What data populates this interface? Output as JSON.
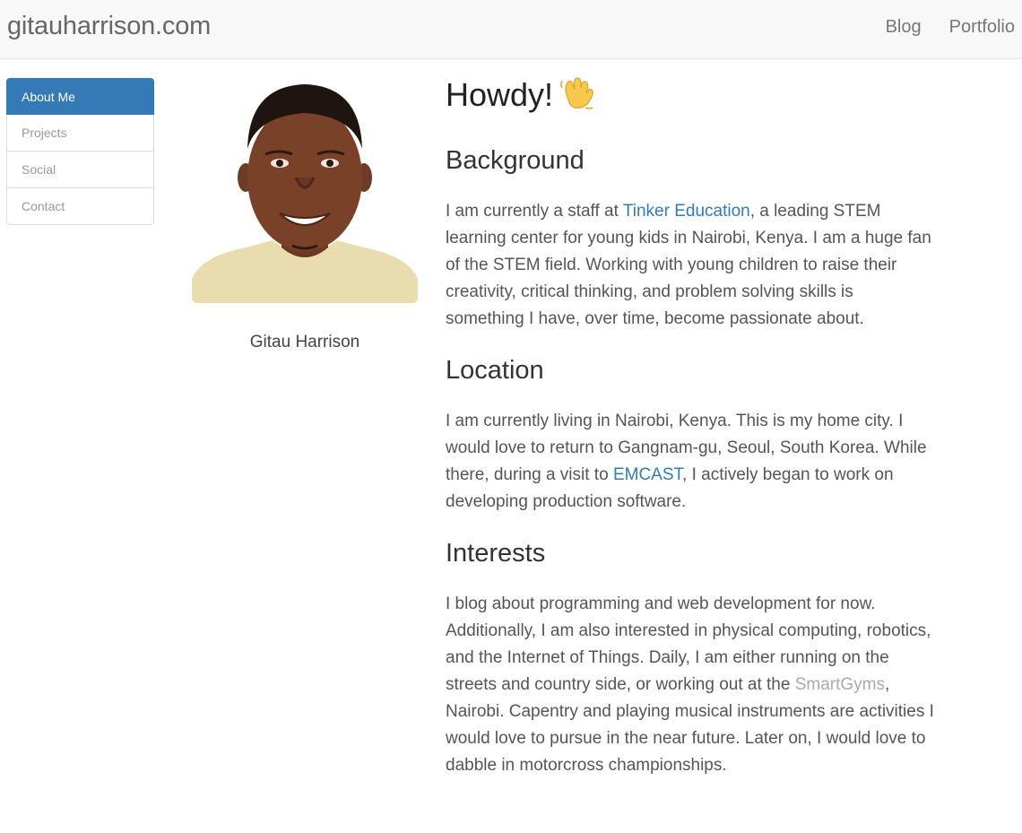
{
  "navbar": {
    "brand": "gitauharrison.com",
    "links": [
      {
        "label": "Blog"
      },
      {
        "label": "Portfolio"
      }
    ]
  },
  "sidebar": {
    "items": [
      {
        "label": "About Me",
        "active": true
      },
      {
        "label": "Projects",
        "active": false
      },
      {
        "label": "Social",
        "active": false
      },
      {
        "label": "Contact",
        "active": false
      }
    ]
  },
  "profile": {
    "name": "Gitau Harrison"
  },
  "content": {
    "heading": "Howdy!",
    "wave_icon": "waving-hand-icon",
    "sections": [
      {
        "title": "Background",
        "parts": [
          {
            "text": "I am currently a staff at "
          },
          {
            "link": "Tinker Education"
          },
          {
            "text": ", a leading STEM learning center for young kids in Nairobi, Kenya. I am a huge fan of the STEM field. Working with young children to raise their creativity, critical thinking, and problem solving skills is something I have, over time, become passionate about."
          }
        ]
      },
      {
        "title": "Location",
        "parts": [
          {
            "text": "I am currently living in Nairobi, Kenya. This is my home city. I would love to return to Gangnam-gu, Seoul, South Korea. While there, during a visit to "
          },
          {
            "link": "EMCAST"
          },
          {
            "text": ", I actively began to work on developing production software."
          }
        ]
      },
      {
        "title": "Interests",
        "parts": [
          {
            "text": "I blog about programming and web development for now. Additionally, I am also interested in physical computing, robotics, and the Internet of Things. Daily, I am either running on the streets and country side, or working out at the "
          },
          {
            "link": "SmartGyms"
          },
          {
            "text": ", Nairobi. Capentry and playing musical instruments are activities I would love to pursue in the near future. Later on, I would love to dabble in motorcross championships."
          }
        ]
      }
    ]
  },
  "colors": {
    "accent": "#337ab7",
    "navbar_bg": "#f8f8f8",
    "muted_link": "#aaaaaa"
  }
}
